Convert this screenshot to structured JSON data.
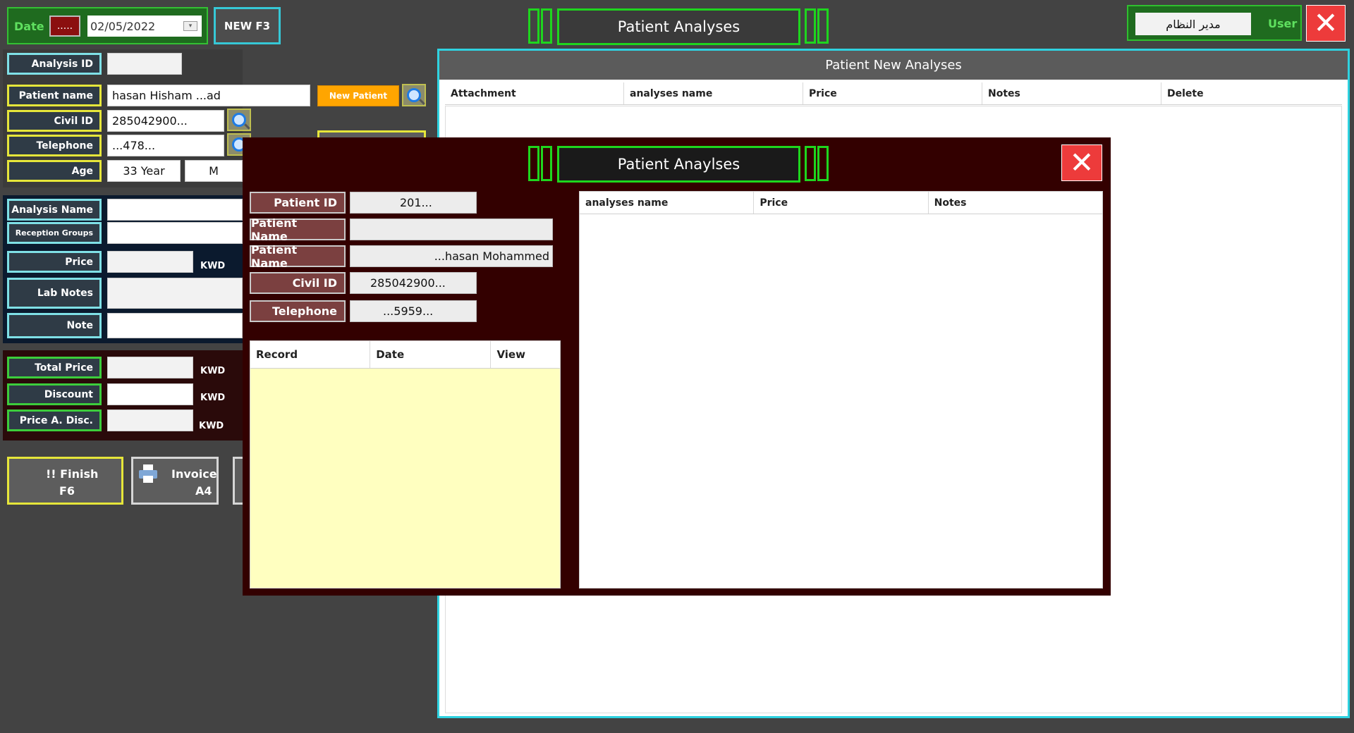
{
  "topbar": {
    "date_label": "Date",
    "date_picker_label": ".....",
    "date_value": "02/05/2022",
    "new_button": "NEW F3",
    "title": "Patient Analyses",
    "user_name": "مدير النظام",
    "user_label": "User"
  },
  "patient": {
    "analysis_id_label": "Analysis ID",
    "analysis_id_value": "",
    "name_label": "Patient name",
    "name_value": "hasan Hisham ...ad",
    "new_patient_button": "New Patient",
    "civil_id_label": "Civil ID",
    "civil_id_value": "285042900...",
    "telephone_label": "Telephone",
    "telephone_value": "...478...",
    "age_label": "Age",
    "age_value": "33 Year",
    "gender_value": "M"
  },
  "analysis": {
    "name_label": "Analysis Name",
    "name_value": "",
    "groups_label": "Reception Groups",
    "groups_value": "",
    "price_label": "Price",
    "price_value": "",
    "price_unit": "KWD",
    "lab_notes_label": "Lab Notes",
    "lab_notes_value": "",
    "note_label": "Note",
    "note_value": ""
  },
  "totals": {
    "total_label": "Total Price",
    "total_value": "",
    "total_unit": "KWD",
    "discount_label": "Discount",
    "discount_value": "",
    "discount_unit": "KWD",
    "after_label": "Price A. Disc.",
    "after_value": "",
    "after_unit": "KWD"
  },
  "actions": {
    "finish_line1": "!! Finish",
    "finish_line2": "F6",
    "invoice_line1": "Invoice",
    "invoice_line2": "A4"
  },
  "new_analyses": {
    "title": "Patient New Analyses",
    "columns": [
      "Attachment",
      "analyses name",
      "Price",
      "Notes",
      "Delete"
    ]
  },
  "modal": {
    "title": "Patient Anaylses",
    "patient_id_label": "Patient ID",
    "patient_id_value": "201...",
    "patient_name_label": "Patient Name",
    "patient_name_value": "",
    "patient_name2_label": "Patient Name",
    "patient_name2_value": "...hasan Mohammed",
    "civil_id_label": "Civil ID",
    "civil_id_value": "285042900...",
    "telephone_label": "Telephone",
    "telephone_value": "...5959...",
    "records_columns": [
      "Record",
      "Date",
      "View"
    ],
    "analyses_columns": [
      "analyses name",
      "Price",
      "Notes"
    ]
  }
}
